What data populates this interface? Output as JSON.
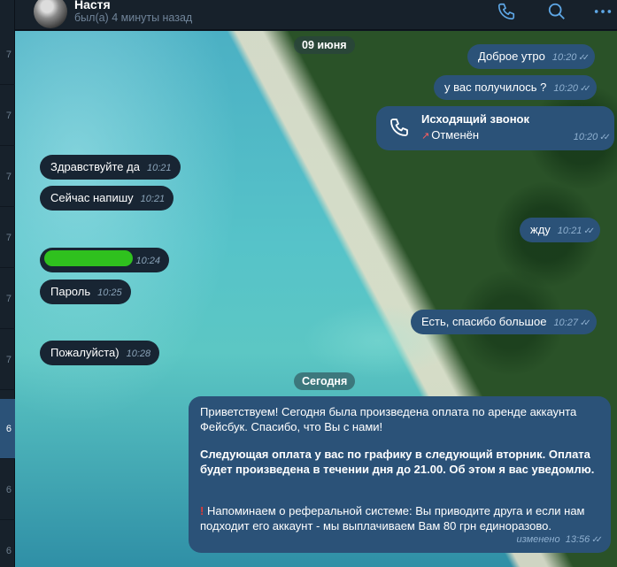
{
  "left_strip": {
    "items": [
      "7",
      "7",
      "7",
      "7",
      "7",
      "7",
      "6",
      "6",
      "6"
    ]
  },
  "header": {
    "name": "Настя",
    "status": "был(а) 4 минуты назад"
  },
  "dates": {
    "first": "09 июня",
    "today": "Сегодня"
  },
  "messages": {
    "out1": {
      "text": "Доброе утро",
      "time": "10:20"
    },
    "out2": {
      "text": "у вас получилось ?",
      "time": "10:20"
    },
    "call": {
      "title": "Исходящий звонок",
      "status": "Отменён",
      "time": "10:20"
    },
    "in1": {
      "text": "Здравствуйте да",
      "time": "10:21"
    },
    "in2": {
      "text": "Сейчас напишу",
      "time": "10:21"
    },
    "out3": {
      "text": "жду",
      "time": "10:21"
    },
    "in3": {
      "time": "10:24"
    },
    "in4": {
      "text": "Пароль",
      "time": "10:25"
    },
    "out4": {
      "text": "Есть, спасибо большое",
      "time": "10:27"
    },
    "in5": {
      "text": "Пожалуйста)",
      "time": "10:28"
    },
    "big": {
      "p1": "Приветствуем! Сегодня была произведена оплата по аренде аккаунта Фейсбук. Спасибо, что Вы с нами!",
      "p2": "Следующая оплата у вас по графику в следующий вторник. Оплата будет произведена в течении дня до 21.00. Об этом я вас уведомлю.",
      "p3_icon": "!",
      "p3": "Напоминаем о реферальной системе: Вы приводите друга и если нам подходит его аккаунт - мы выплачиваем Вам 80 грн единоразово.",
      "edited": "изменено",
      "time": "13:56"
    }
  },
  "icons": {
    "call": "phone-icon",
    "search": "search-icon",
    "more": "more-dots-icon",
    "read": "double-check-icon",
    "outgoing_arrow": "arrow-up-right-icon"
  },
  "colors": {
    "bubble_in": "#182533",
    "bubble_out": "#2b5278",
    "header_bg": "#17212b",
    "accent": "#5ea7e6",
    "redaction": "#2fc11e",
    "missed_red": "#ff5e5e"
  }
}
